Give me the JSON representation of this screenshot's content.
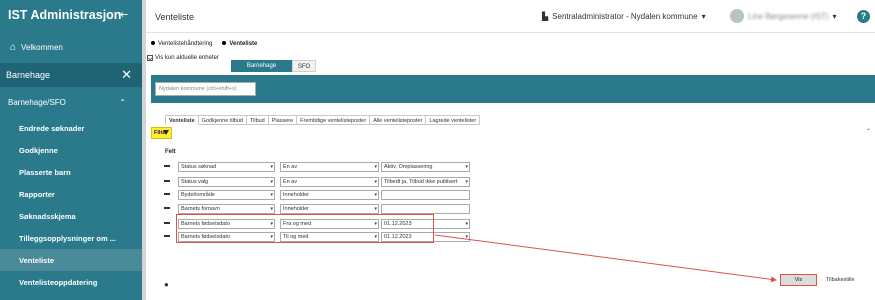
{
  "sidebar": {
    "brand": "IST Administrasjon",
    "collapse_icon": "menu-collapse-icon",
    "home": "Velkommen",
    "section": "Barnehage",
    "section_close_icon": "close-icon",
    "group": "Barnehage/SFO",
    "items": [
      {
        "label": "Endrede søknader"
      },
      {
        "label": "Godkjenne"
      },
      {
        "label": "Plasserte barn"
      },
      {
        "label": "Rapporter"
      },
      {
        "label": "Søknadsskjema"
      },
      {
        "label": "Tilleggsopplysninger om ..."
      },
      {
        "label": "Venteliste"
      },
      {
        "label": "Ventelisteoppdatering"
      }
    ],
    "active_index": 6
  },
  "header": {
    "title": "Venteliste",
    "org": "Sentraladministrator - Nydalen kommune",
    "user": "Line Børgesevne (IST)",
    "help": "?"
  },
  "radios": {
    "option1": "Ventelistehåndtering",
    "option2": "Venteliste"
  },
  "checkbox": {
    "label": "Vis kun aktuelle enheter"
  },
  "segments": {
    "active": "Barnehage",
    "other": "SFO"
  },
  "search": {
    "placeholder": "Nydalen kommune (ctrl+shift+s)"
  },
  "tabs": [
    "Venteliste",
    "Godkjenne tilbud",
    "Tilbud",
    "Plassere",
    "Fremtidige ventelisteposter",
    "Alle ventelisteposter",
    "Lagrede ventelister"
  ],
  "filter": {
    "button": "Filter",
    "felt_label": "Felt"
  },
  "filter_rows": [
    {
      "field": "Status søknad",
      "op": "En av",
      "value": "Aktiv, Omplassering"
    },
    {
      "field": "Status valg",
      "op": "En av",
      "value": "Tilbedt ja, Tilbud ikke publisert"
    },
    {
      "field": "Bydel/område",
      "op": "Inneholder",
      "value": ""
    },
    {
      "field": "Barnets fornavn",
      "op": "Inneholder",
      "value": ""
    },
    {
      "field": "Barnets fødselsdato",
      "op": "Fra og med",
      "value": "01.12.2023"
    },
    {
      "field": "Barnets fødselsdato",
      "op": "Til og med",
      "value": "01.12.2023"
    }
  ],
  "actions": {
    "show": "Vis",
    "reset": "Tilbakestille"
  },
  "colors": {
    "sidebar": "#2a7a8c",
    "highlight": "#d9534f",
    "filter_yellow": "#ffeb3b"
  }
}
